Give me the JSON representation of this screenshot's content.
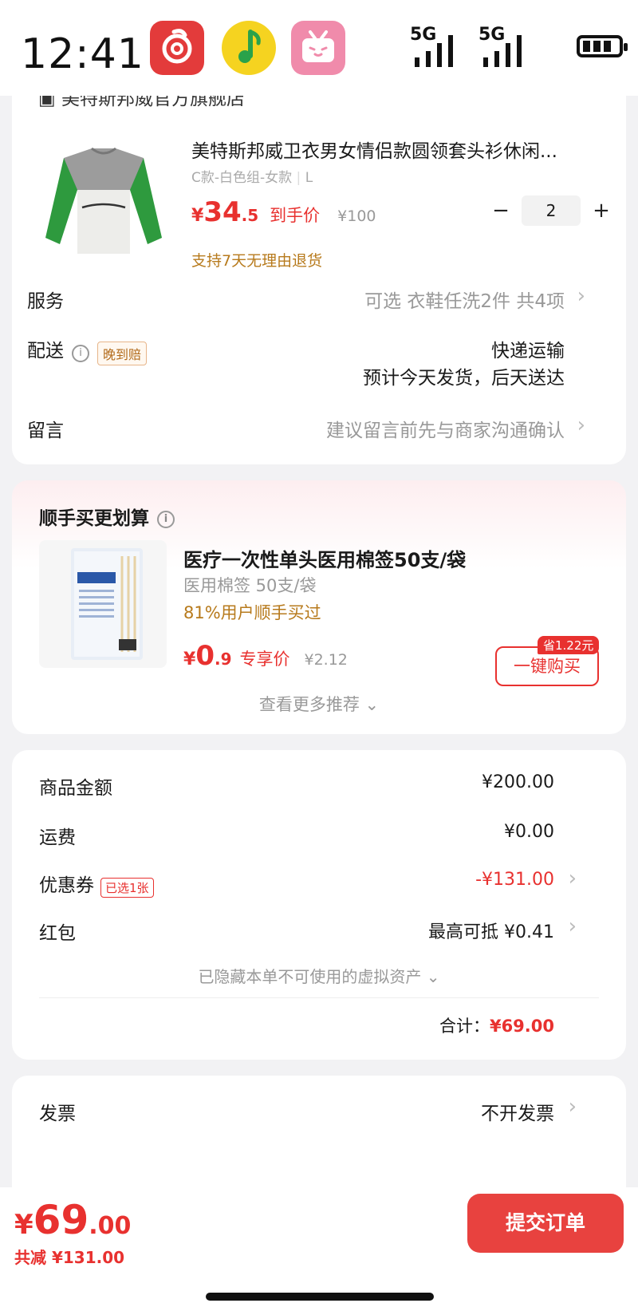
{
  "status_bar": {
    "time": "12:41",
    "signal_label_1": "5G",
    "signal_label_2": "5G"
  },
  "store": {
    "name": "美特斯邦威官方旗舰店"
  },
  "product": {
    "title": "美特斯邦威卫衣男女情侣款圆领套头衫休闲...",
    "spec": "C款-白色组-女款",
    "size": "L",
    "price_yen": "¥",
    "price_int": "34",
    "price_dec": ".5",
    "price_tag": "到手价",
    "original_price": "¥100",
    "quantity": "2",
    "minus": "−",
    "plus": "+",
    "return_policy": "支持7天无理由退货"
  },
  "service": {
    "label": "服务",
    "value": "可选 衣鞋任洗2件 共4项"
  },
  "delivery": {
    "label": "配送",
    "badge": "晚到赔",
    "method": "快递运输",
    "eta": "预计今天发货，后天送达"
  },
  "message": {
    "label": "留言",
    "placeholder": "建议留言前先与商家沟通确认"
  },
  "recommend": {
    "section_title": "顺手买更划算",
    "title": "医疗一次性单头医用棉签50支/袋",
    "spec": "医用棉签 50支/袋",
    "popularity": "81%用户顺手买过",
    "price_yen": "¥",
    "price_int": "0",
    "price_dec": ".9",
    "price_tag": "专享价",
    "original_price": "¥2.12",
    "save_badge": "省1.22元",
    "buy_button": "一键购买",
    "more": "查看更多推荐"
  },
  "summary": {
    "goods_label": "商品金额",
    "goods_value": "¥200.00",
    "shipping_label": "运费",
    "shipping_value": "¥0.00",
    "coupon_label": "优惠券",
    "coupon_badge": "已选1张",
    "coupon_value": "-¥131.00",
    "redpacket_label": "红包",
    "redpacket_value": "最高可抵 ¥0.41",
    "hidden_assets": "已隐藏本单不可使用的虚拟资产",
    "total_label": "合计：",
    "total_value": "¥69.00"
  },
  "invoice": {
    "label": "发票",
    "value": "不开发票"
  },
  "bottom": {
    "yen": "¥",
    "int": "69",
    "dec": ".00",
    "saved": "共减 ¥131.00",
    "submit": "提交订单"
  },
  "colors": {
    "accent": "#e8312f",
    "gold": "#b77a1c",
    "button": "#e8423f"
  }
}
